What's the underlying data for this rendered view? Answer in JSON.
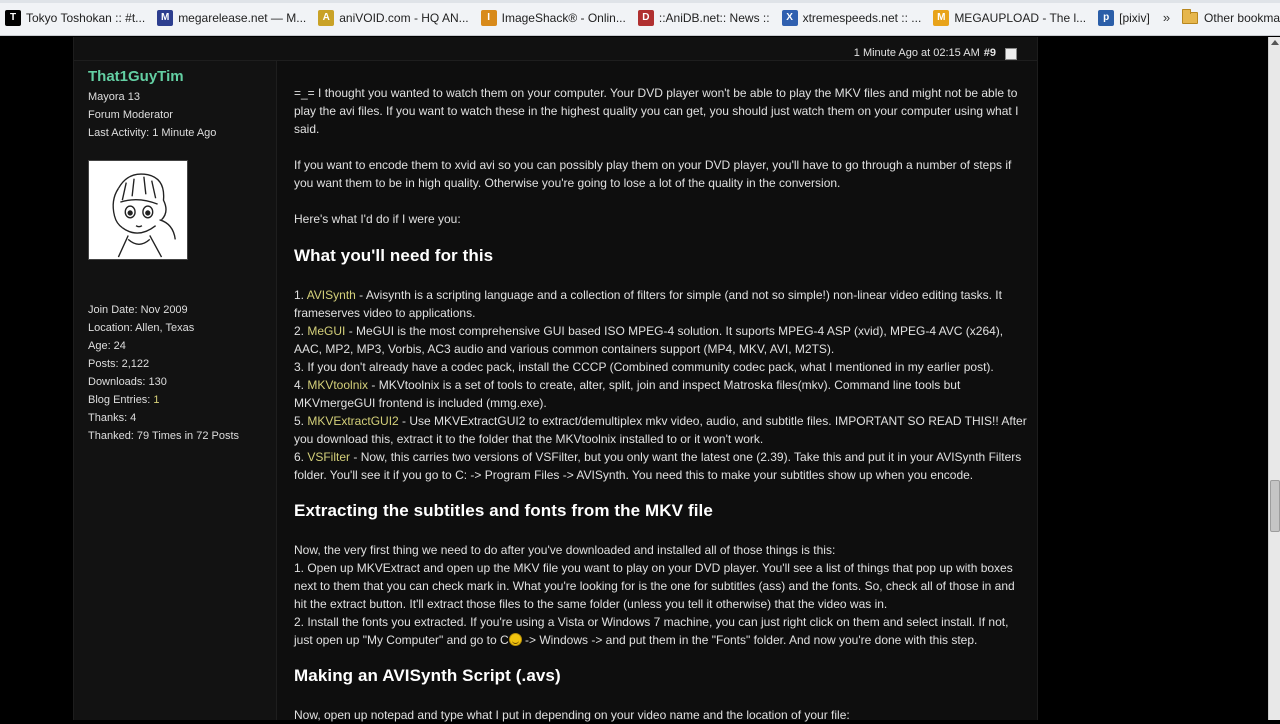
{
  "bookmarks": [
    {
      "label": "Tokyo Toshokan :: #t...",
      "icon": "T",
      "color": "#000000"
    },
    {
      "label": "megarelease.net — M...",
      "icon": "M",
      "color": "#2d3e8f"
    },
    {
      "label": "aniVOID.com - HQ AN...",
      "icon": "A",
      "color": "#c9a227"
    },
    {
      "label": "ImageShack® - Onlin...",
      "icon": "I",
      "color": "#d88a1a"
    },
    {
      "label": "::AniDB.net:: News ::",
      "icon": "D",
      "color": "#b03030"
    },
    {
      "label": "xtremespeeds.net :: ...",
      "icon": "X",
      "color": "#3060b0"
    },
    {
      "label": "MEGAUPLOAD - The l...",
      "icon": "M",
      "color": "#e8a31a"
    },
    {
      "label": "[pixiv]",
      "icon": "p",
      "color": "#2b5ea8"
    }
  ],
  "bookmarks_more": "»",
  "other_bookmarks": "Other bookmarks",
  "post": {
    "time": "1 Minute Ago at 02:15 AM",
    "number": "#9"
  },
  "user": {
    "name": "That1GuyTim",
    "title": "Mayora 13",
    "role": "Forum Moderator",
    "last_activity": "Last Activity: 1 Minute Ago",
    "join_date": "Join Date: Nov 2009",
    "location": "Location: Allen, Texas",
    "age": "Age: 24",
    "posts": "Posts: 2,122",
    "downloads": "Downloads: 130",
    "blog_label": "Blog Entries: ",
    "blog_value": "1",
    "thanks": "Thanks: 4",
    "thanked": "Thanked: 79 Times in 72 Posts"
  },
  "content": {
    "p1": "=_= I thought you wanted to watch them on your computer. Your DVD player won't be able to play the MKV files and might not be able to play the avi files. If you want to watch these in the highest quality you can get, you should just watch them on your computer using what I said.",
    "p2": "If you want to encode them to xvid avi so you can possibly play them on your DVD player, you'll have to go through a number of steps if you want them to be in high quality. Otherwise you're going to lose a lot of the quality in the conversion.",
    "p3": "Here's what I'd do if I were you:",
    "h1": "What you'll need for this",
    "list": [
      {
        "pre": "1. ",
        "link": "AVISynth",
        "text": " - Avisynth is a scripting language and a collection of filters for simple (and not so simple!) non-linear video editing tasks. It frameserves video to applications."
      },
      {
        "pre": "2. ",
        "link": "MeGUI",
        "text": " - MeGUI is the most comprehensive GUI based ISO MPEG-4 solution. It suports MPEG-4 ASP (xvid), MPEG-4 AVC (x264), AAC, MP2, MP3, Vorbis, AC3 audio and various common containers support (MP4, MKV, AVI, M2TS)."
      },
      {
        "pre": "",
        "link": "",
        "text": "3. If you don't already have a codec pack, install the CCCP (Combined community codec pack, what I mentioned in my earlier post)."
      },
      {
        "pre": "4. ",
        "link": "MKVtoolnix",
        "text": " - MKVtoolnix is a set of tools to create, alter, split, join and inspect Matroska files(mkv). Command line tools but MKVmergeGUI frontend is included (mmg.exe)."
      },
      {
        "pre": "5. ",
        "link": "MKVExtractGUI2",
        "text": " - Use MKVExtractGUI2 to extract/demultiplex mkv video, audio, and subtitle files. IMPORTANT SO READ THIS!! After you download this, extract it to the folder that the MKVtoolnix installed to or it won't work."
      },
      {
        "pre": "6. ",
        "link": "VSFilter",
        "text": " - Now, this carries two versions of VSFilter, but you only want the latest one (2.39). Take this and put it in your AVISynth Filters folder. You'll see it if you go to C: -> Program Files -> AVISynth. You need this to make your subtitles show up when you encode."
      }
    ],
    "h2": "Extracting the subtitles and fonts from the MKV file",
    "p4": "Now, the very first thing we need to do after you've downloaded and installed all of those things is this:",
    "s1": "1. Open up MKVExtract and open up the MKV file you want to play on your DVD player. You'll see a list of things that pop up with boxes next to them that you can check mark in. What you're looking for is the one for subtitles (ass) and the fonts. So, check all of those in and hit the extract button. It'll extract those files to the same folder (unless you tell it otherwise) that the video was in.",
    "s2a": "2. Install the fonts you extracted. If you're using a Vista or Windows 7 machine, you can just right click on them and select install. If not, just open up \"My Computer\" and go to C",
    "s2b": " -> Windows -> and put them in the \"Fonts\" folder. And now you're done with this step.",
    "h3": "Making an AVISynth Script (.avs)",
    "p5": "Now, open up notepad and type what I put in depending on your video name and the location of your file:"
  }
}
